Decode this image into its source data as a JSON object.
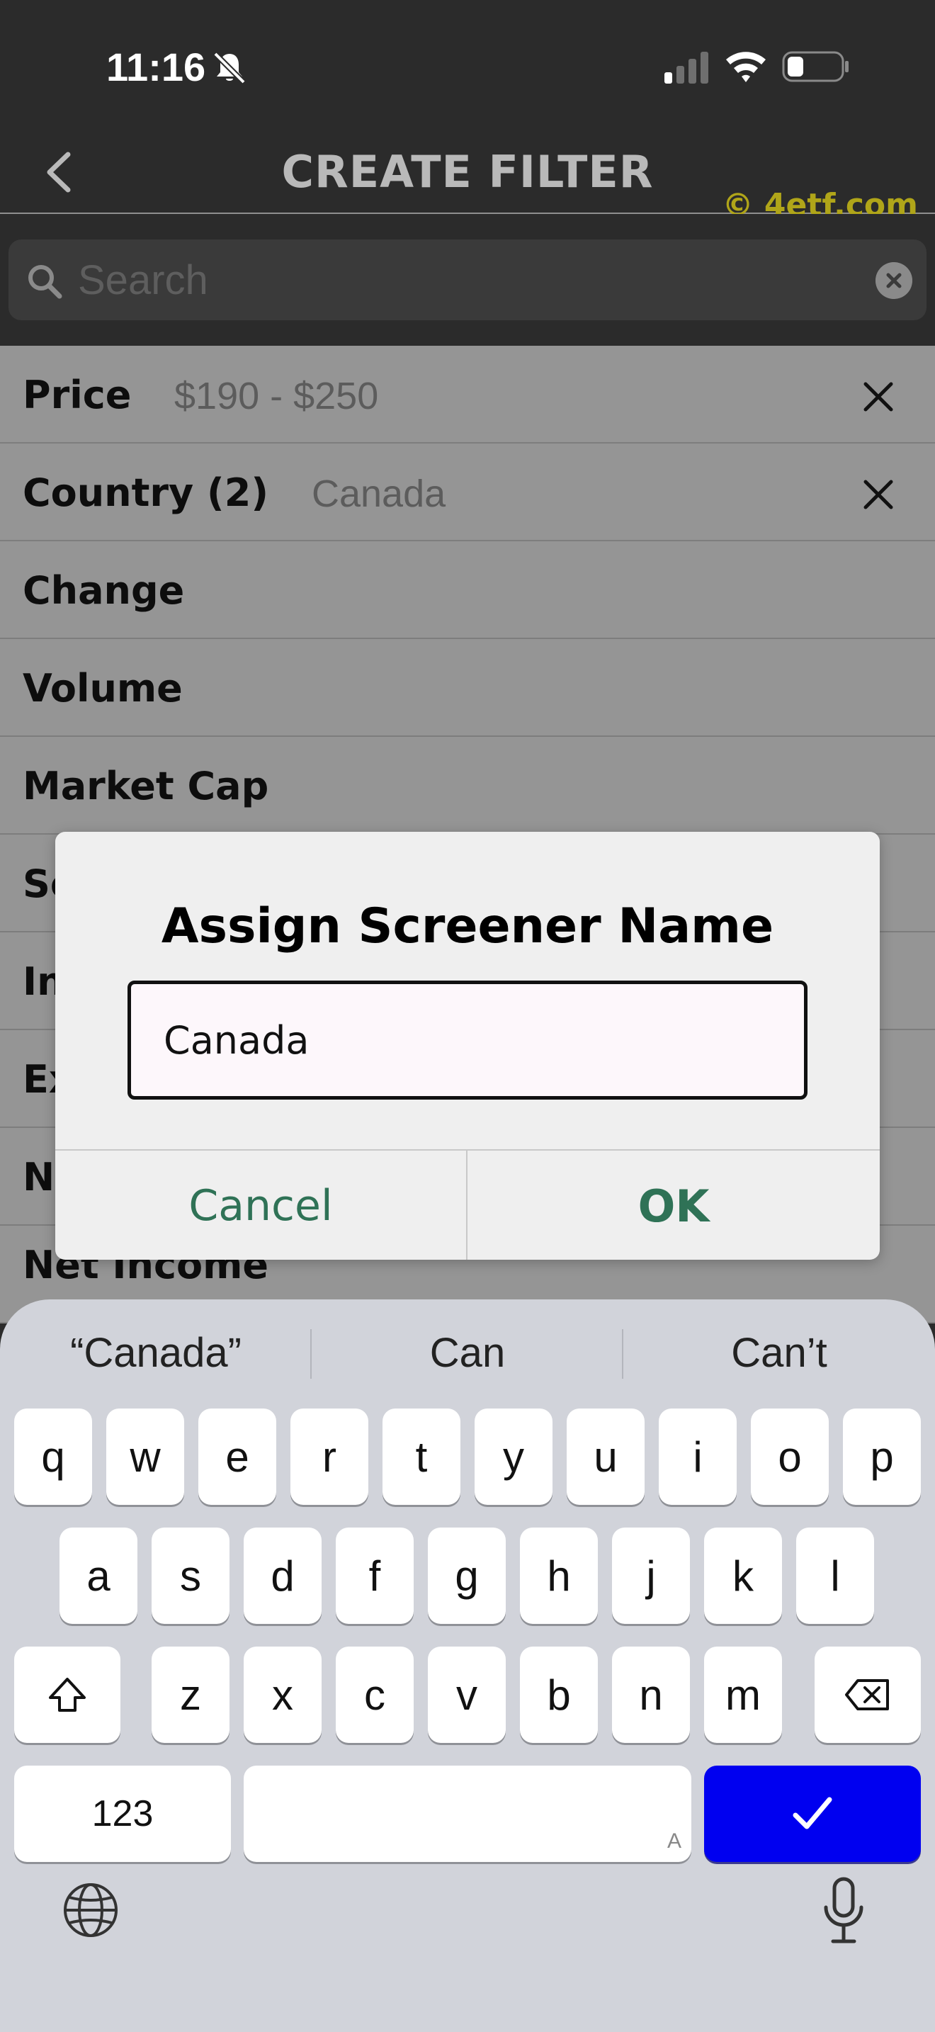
{
  "status_bar": {
    "time": "11:16",
    "icons": [
      "silent-mode-icon",
      "cellular-signal-icon",
      "wifi-icon",
      "battery-icon"
    ]
  },
  "nav": {
    "title": "CREATE FILTER",
    "watermark": "© 4etf.com",
    "back_icon": "chevron-left-icon"
  },
  "search": {
    "placeholder": "Search",
    "value": "",
    "clear_icon": "clear-circle-icon"
  },
  "filters": [
    {
      "label": "Price",
      "value": "$190 - $250",
      "removable": true
    },
    {
      "label": "Country (2)",
      "value": "Canada",
      "removable": true
    },
    {
      "label": "Change",
      "value": "",
      "removable": false
    },
    {
      "label": "Volume",
      "value": "",
      "removable": false
    },
    {
      "label": "Market Cap",
      "value": "",
      "removable": false
    },
    {
      "label": "Se",
      "value": "",
      "removable": false
    },
    {
      "label": "In",
      "value": "",
      "removable": false
    },
    {
      "label": "Ex",
      "value": "",
      "removable": false
    },
    {
      "label": "Ne",
      "value": "",
      "removable": false
    },
    {
      "label": "Net Income",
      "value": "",
      "removable": false
    }
  ],
  "dialog": {
    "title": "Assign Screener Name",
    "input_value": "Canada",
    "cancel_label": "Cancel",
    "ok_label": "OK"
  },
  "keyboard": {
    "suggestions": [
      "“Canada”",
      "Can",
      "Can’t"
    ],
    "row1": [
      "q",
      "w",
      "e",
      "r",
      "t",
      "y",
      "u",
      "i",
      "o",
      "p"
    ],
    "row2": [
      "a",
      "s",
      "d",
      "f",
      "g",
      "h",
      "j",
      "k",
      "l"
    ],
    "row3": [
      "z",
      "x",
      "c",
      "v",
      "b",
      "n",
      "m"
    ],
    "numbers_label": "123",
    "space_hint": "A",
    "done_color": "#0000f0"
  },
  "colors": {
    "background": "#2b2b2b",
    "list_bg": "#959595",
    "dialog_button": "#2f7256",
    "watermark": "#b0a519"
  }
}
